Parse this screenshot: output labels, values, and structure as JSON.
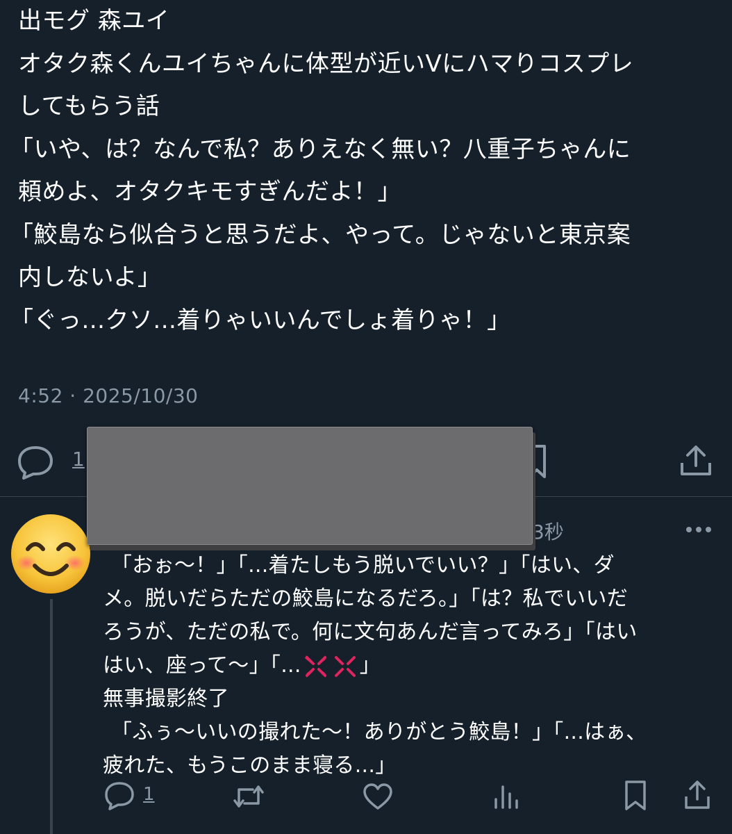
{
  "post": {
    "lines": [
      "出モグ 森ユイ",
      "オタク森くんユイちゃんに体型が近いVにハマりコスプレ",
      "してもらう話",
      "「いや、は？なんで私？ありえなく無い？八重子ちゃんに",
      "頼めよ、オタクキモすぎんだよ！」",
      "「鮫島なら似合うと思うだよ、やって。じゃないと東京案",
      "内しないよ」",
      "「ぐっ...クソ...着りゃいいんでしょ着りゃ！」"
    ],
    "timestamp": "4:52 · 2025/10/30",
    "reply_count": "1"
  },
  "reply": {
    "time": "3秒",
    "lines": [
      "「おぉ〜！」「...着たしもう脱いでいい？」「はい、ダ",
      "メ。脱いだらただの鮫島になるだろ。」「は？私でいいだ",
      "ろうが、ただの私で。何に文句あんだ言ってみろ」「はい",
      "無事撮影終了",
      "「ふぅ〜いいの撮れた〜！ありがとう鮫島！」「...はぁ、",
      "疲れた、もうこのまま寝る...」"
    ],
    "line4_prefix": "はい、座って〜」「...",
    "line4_suffix": "」",
    "reply_count": "1"
  },
  "icons": {
    "reply": "reply-icon",
    "retweet": "retweet-icon",
    "like": "heart-icon",
    "views": "views-icon",
    "bookmark": "bookmark-icon",
    "share": "share-icon",
    "more": "more-icon",
    "anger": "anger-symbol-icon",
    "avatar": "smiling-face-icon"
  },
  "colors": {
    "background": "#15202b",
    "text": "#ffffff",
    "muted": "#8b98a5",
    "divider": "#38444d",
    "redaction": "#6c6c6e",
    "anger": "#e0245e"
  }
}
